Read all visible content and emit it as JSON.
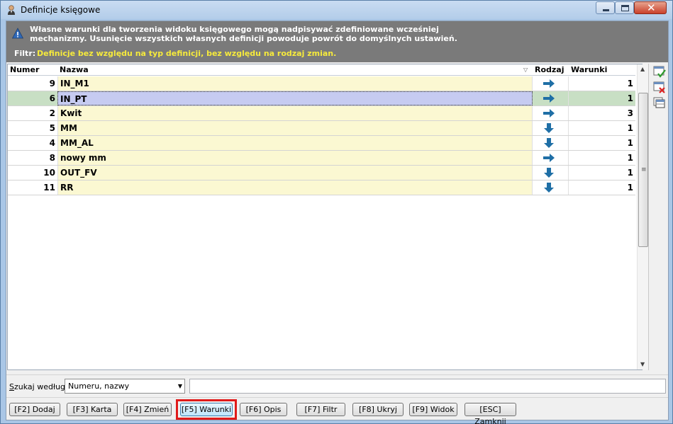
{
  "window": {
    "title": "Definicje księgowe"
  },
  "info": {
    "message": "Własne warunki dla tworzenia widoku księgowego mogą nadpisywać zdefiniowane wcześniej mechanizmy. Usunięcie wszystkich własnych definicji powoduje powrót do domyślnych ustawień.",
    "filter_label": "Filtr:",
    "filter_text": "Definicje bez względu na typ definicji, bez względu na rodzaj zmian."
  },
  "grid": {
    "columns": {
      "number": "Numer",
      "name": "Nazwa",
      "kind": "Rodzaj",
      "conditions": "Warunki"
    },
    "rows": [
      {
        "number": "9",
        "name": "IN_M1",
        "kind": "arrow-right-icon",
        "conditions": "1"
      },
      {
        "number": "6",
        "name": "IN_PT",
        "kind": "arrow-right-icon",
        "conditions": "1",
        "selected": true
      },
      {
        "number": "2",
        "name": "Kwit",
        "kind": "arrow-right-icon",
        "conditions": "3"
      },
      {
        "number": "5",
        "name": "MM",
        "kind": "arrow-down-icon",
        "conditions": "1"
      },
      {
        "number": "4",
        "name": "MM_AL",
        "kind": "arrow-down-icon",
        "conditions": "1"
      },
      {
        "number": "8",
        "name": "nowy mm",
        "kind": "arrow-right-icon",
        "conditions": "1"
      },
      {
        "number": "10",
        "name": "OUT_FV",
        "kind": "arrow-down-icon",
        "conditions": "1"
      },
      {
        "number": "11",
        "name": "RR",
        "kind": "arrow-down-icon",
        "conditions": "1"
      }
    ]
  },
  "search": {
    "label_underlined": "S",
    "label_rest": "zukaj według:",
    "select_value": "Numeru, nazwy",
    "input_value": ""
  },
  "buttons": {
    "add": "[F2] Dodaj",
    "card": "[F3] Karta",
    "edit": "[F4] Zmień",
    "conditions": "[F5] Warunki",
    "description": "[F6] Opis",
    "filter": "[F7] Filtr",
    "hide": "[F8] Ukryj",
    "view": "[F9] Widok",
    "close": "[ESC] Zamknij"
  },
  "colors": {
    "accent_arrow": "#1f6fa6",
    "highlight": "#e01a1a",
    "filter_text": "#f6ea3c"
  }
}
